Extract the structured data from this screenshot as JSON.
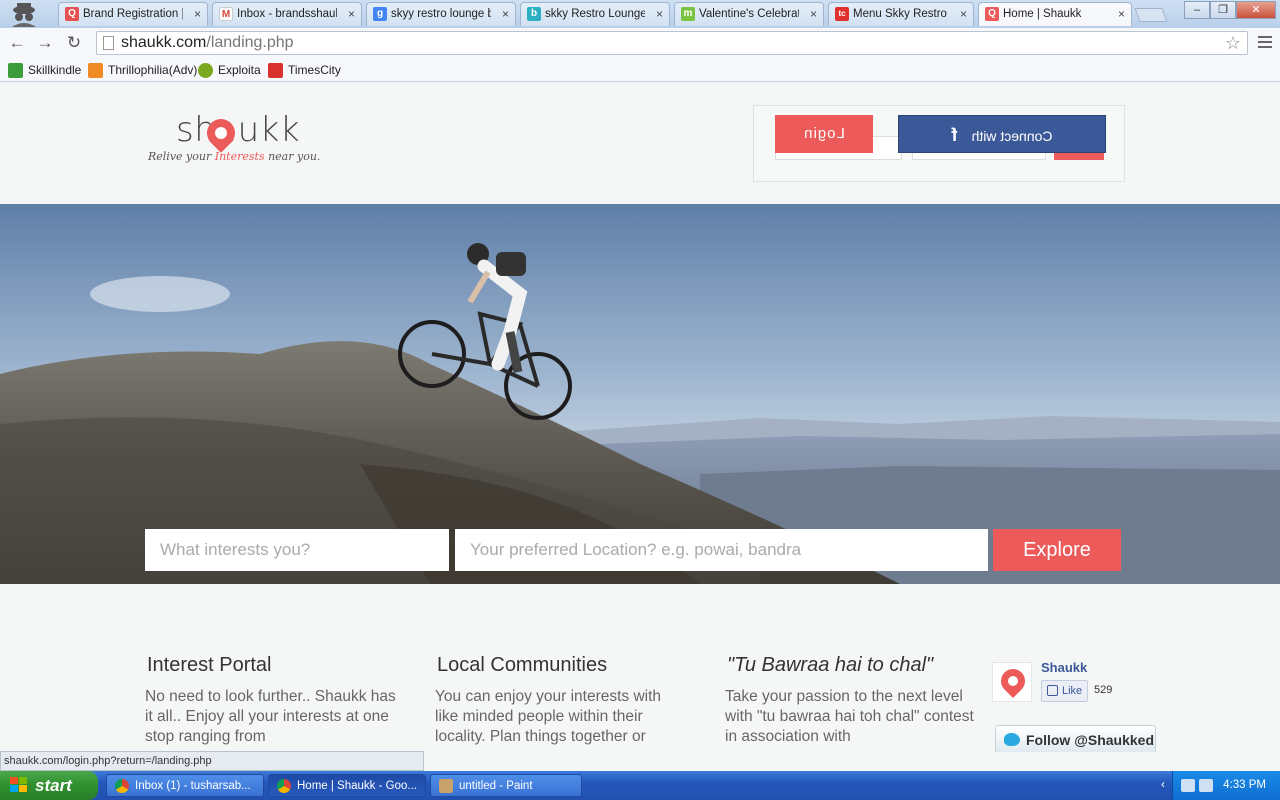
{
  "browser": {
    "tabs": [
      {
        "title": "Brand Registration | S",
        "favicon_color": "#e55050",
        "favicon_glyph": "Q"
      },
      {
        "title": "Inbox - brandsshauk",
        "favicon_color": "#d44638",
        "favicon_glyph": "M"
      },
      {
        "title": "skyy restro lounge ba",
        "favicon_color": "#4285f4",
        "favicon_glyph": "g"
      },
      {
        "title": "skky Restro Lounge",
        "favicon_color": "#2bb0c4",
        "favicon_glyph": "b"
      },
      {
        "title": "Valentine's Celebratio",
        "favicon_color": "#7cc242",
        "favicon_glyph": "m"
      },
      {
        "title": "Menu Skky Restro Lo",
        "favicon_color": "#e0312d",
        "favicon_glyph": "tc"
      },
      {
        "title": "Home | Shaukk",
        "favicon_color": "#ec5a5a",
        "favicon_glyph": "Q"
      }
    ],
    "url_host": "shaukk.com",
    "url_path": "/landing.php",
    "bookmarks": [
      {
        "label": "Skillkindle",
        "color": "#3a9d3a"
      },
      {
        "label": "Thrillophilia(Adv)",
        "color": "#f08a24"
      },
      {
        "label": "Exploita",
        "color": "#7aa81e"
      },
      {
        "label": "TimesCity",
        "color": "#d93030"
      }
    ],
    "status_url": "shaukk.com/login.php?return=/landing.php"
  },
  "site": {
    "logo_text": "shaukk",
    "tagline_pre": "Relive your ",
    "tagline_highlight": "Interests",
    "tagline_post": " near you.",
    "login_label": "Login",
    "connect_label": "Connect with",
    "fb_glyph": "f",
    "accent": "#ec5a5a",
    "search": {
      "interest_placeholder": "What interests you?",
      "location_placeholder": "Your preferred Location? e.g. powai, bandra",
      "explore_label": "Explore"
    },
    "features": [
      {
        "title": "Interest Portal",
        "text": "No need to look further.. Shaukk has it all.. Enjoy all your interests at one stop ranging from"
      },
      {
        "title": "Local Communities",
        "text": "You can enjoy your interests with like minded people within their locality. Plan things together or"
      },
      {
        "title": "\"Tu Bawraa hai to chal\"",
        "text": "Take your passion to the next level with \"tu bawraa hai toh chal\" contest in association with"
      }
    ],
    "facebook": {
      "page_name": "Shaukk",
      "like_label": "Like",
      "like_count": "529"
    },
    "twitter": {
      "follow_label": "Follow @Shaukked"
    }
  },
  "taskbar": {
    "start_label": "start",
    "tasks": [
      {
        "label": "Inbox (1) - tusharsab...",
        "icon_color": "#e8b923"
      },
      {
        "label": "Home | Shaukk - Goo...",
        "icon_color": "#e8b923"
      },
      {
        "label": "untitled - Paint",
        "icon_color": "#c9a26b"
      }
    ],
    "clock": "4:33 PM"
  }
}
